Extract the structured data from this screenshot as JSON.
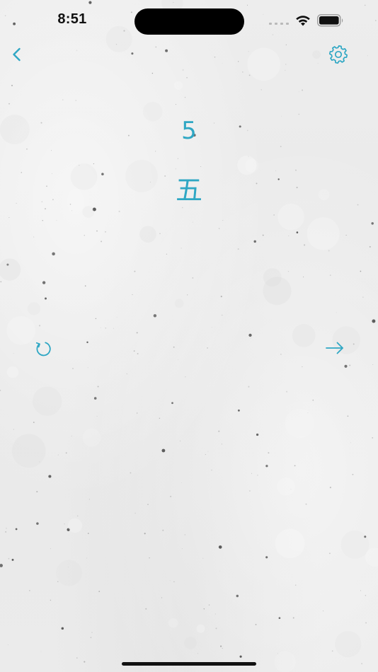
{
  "status_bar": {
    "time": "8:51"
  },
  "nav": {
    "back_icon": "chevron-left-icon",
    "settings_icon": "gear-icon"
  },
  "card": {
    "number": "5",
    "kanji": "五"
  },
  "actions": {
    "refresh_icon": "refresh-icon",
    "next_icon": "arrow-right-icon"
  },
  "colors": {
    "accent": "#2fa7c4",
    "background": "#ececec"
  }
}
